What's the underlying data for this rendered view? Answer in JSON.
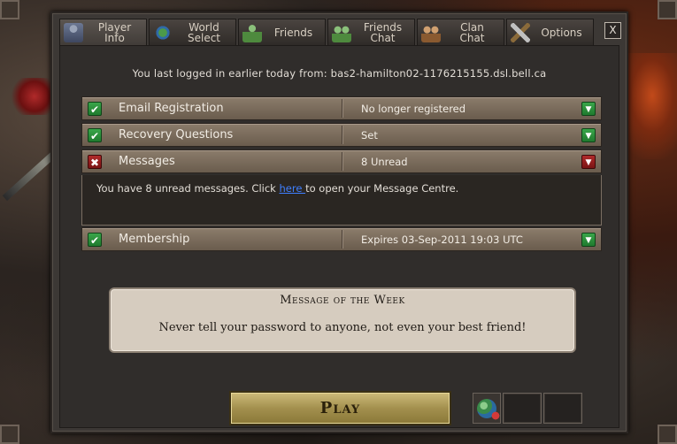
{
  "tabs": [
    {
      "label": "Player\nInfo",
      "icon": "player-icon"
    },
    {
      "label": "World\nSelect",
      "icon": "globe-icon"
    },
    {
      "label": "Friends",
      "icon": "friends-icon"
    },
    {
      "label": "Friends\nChat",
      "icon": "friends-chat-icon"
    },
    {
      "label": "Clan\nChat",
      "icon": "clan-chat-icon"
    },
    {
      "label": "Options",
      "icon": "options-icon"
    }
  ],
  "close_label": "X",
  "last_login": "You last logged in earlier today from: bas2-hamilton02-1176215155.dsl.bell.ca",
  "rows": [
    {
      "label": "Email Registration",
      "value": "No longer registered",
      "status": "ok"
    },
    {
      "label": "Recovery Questions",
      "value": "Set",
      "status": "ok"
    },
    {
      "label": "Messages",
      "value": "8 Unread",
      "status": "bad"
    },
    {
      "label": "Membership",
      "value": "Expires 03-Sep-2011 19:03 UTC",
      "status": "ok"
    }
  ],
  "messages_detail": {
    "before": "You have 8 unread messages. Click ",
    "link": "here ",
    "after": "to open your Message Centre."
  },
  "motw": {
    "title": "Message of the Week",
    "text": "Never tell your password to anyone, not even your best friend!"
  },
  "play_label": "Play",
  "colors": {
    "ok": "#2e8f3e",
    "bad": "#9a1e1e",
    "link": "#3f7fff"
  }
}
